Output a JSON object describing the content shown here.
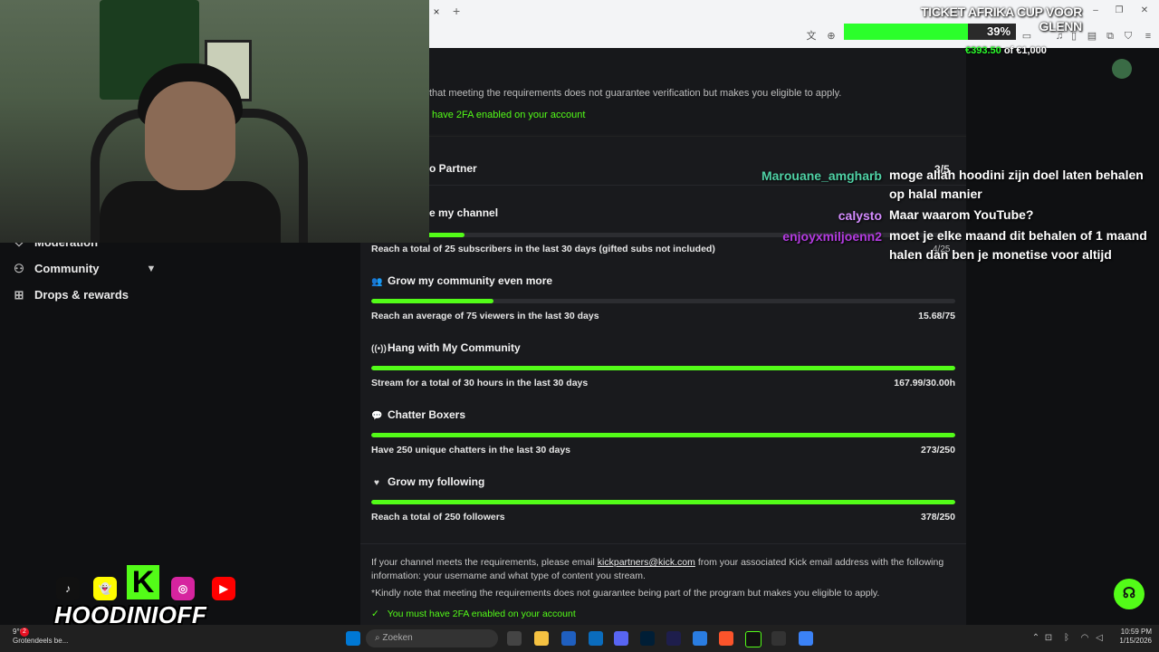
{
  "browser": {
    "close_tab": "×",
    "new_tab": "+"
  },
  "stream_goal": {
    "title": "TICKET AFRIKA CUP VOOR GLENN",
    "percent_label": "39%",
    "progress": 0.39,
    "current": "€393.50",
    "of_target": "of €1,000",
    "bar_color": "#2bff2b"
  },
  "sidebar": {
    "items": [
      {
        "label": "Moderation",
        "icon": "shield-icon"
      },
      {
        "label": "Community",
        "icon": "users-icon"
      },
      {
        "label": "Drops & rewards",
        "icon": "gift-icon"
      }
    ]
  },
  "verification": {
    "note_partial": "that meeting the requirements does not guarantee verification but makes you eligible to apply.",
    "twofa_partial": "have 2FA enabled on your account"
  },
  "partner": {
    "title_partial": "o Partner",
    "count_partial": "3/5",
    "first_goal_partial": "e my channel",
    "first_goal_count_partial": "4/25",
    "first_goal_progress": 0.16,
    "first_goal_req": "Reach a total of 25 subscribers in the last 30 days (gifted subs not included)",
    "goals": [
      {
        "title": "Grow my community even more",
        "icon": "users-icon",
        "req": "Reach an average of 75 viewers in the last 30 days",
        "value": "15.68/75",
        "progress": 0.209
      },
      {
        "title": "Hang with My Community",
        "icon": "broadcast-icon",
        "req": "Stream for a total of 30 hours in the last 30 days",
        "value": "167.99/30.00h",
        "progress": 1.0
      },
      {
        "title": "Chatter Boxers",
        "icon": "chat-icon",
        "req": "Have 250 unique chatters in the last 30 days",
        "value": "273/250",
        "progress": 1.0
      },
      {
        "title": "Grow my following",
        "icon": "heart-icon",
        "req": "Reach a total of 250 followers",
        "value": "378/250",
        "progress": 1.0
      }
    ],
    "footer_prefix": "If your channel meets the requirements, please email ",
    "footer_email": "kickpartners@kick.com",
    "footer_suffix": " from your associated Kick email address with the following information: your username and what type of content you stream.",
    "footer_note": "*Kindly note that meeting the requirements does not guarantee being part of the program but makes you eligible to apply.",
    "footer_twofa": "You must have 2FA enabled on your account",
    "accent": "#53fc18"
  },
  "chat": [
    {
      "user": "Marouane_amgharb",
      "color": "#4fd1a5",
      "message": "moge allah hoodini zijn doel laten behalen op halal manier"
    },
    {
      "user": "calysto",
      "color": "#d48cff",
      "message": "Maar waarom YouTube?"
    },
    {
      "user": "enjoyxmiljoenn2",
      "color": "#b33be0",
      "message": "moet je elke maand dit behalen of 1 maand halen dan ben je monetise voor altijd"
    }
  ],
  "branding": {
    "name": "HOODINIOFF",
    "kick_letter": "K"
  },
  "taskbar": {
    "weather_temp": "9°C",
    "weather_text": "Grotendeels be...",
    "search_placeholder": "Zoeken",
    "time": "10:59 PM",
    "date": "1/15/2026",
    "notif_count": "2"
  },
  "help": {
    "icon": "headset-icon"
  }
}
